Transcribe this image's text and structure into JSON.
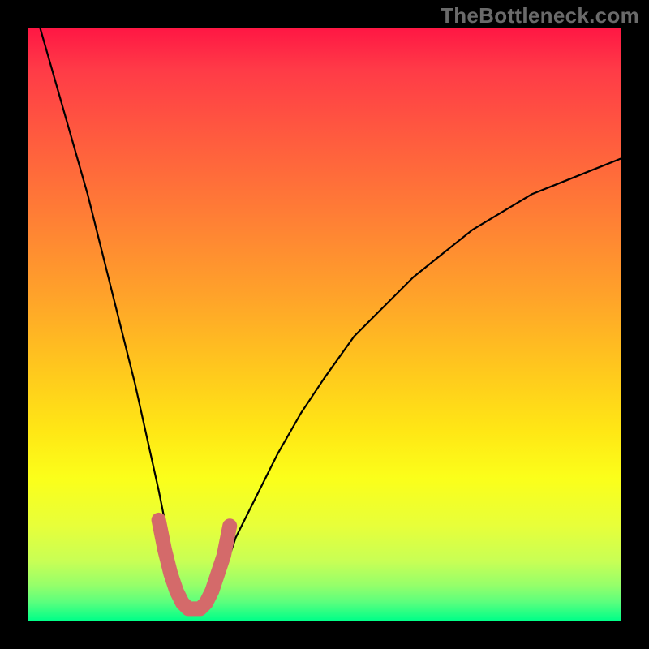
{
  "watermark": "TheBottleneck.com",
  "chart_data": {
    "type": "line",
    "title": "",
    "xlabel": "",
    "ylabel": "",
    "xlim": [
      0,
      100
    ],
    "ylim": [
      0,
      100
    ],
    "series": [
      {
        "name": "curve",
        "x": [
          2,
          4,
          6,
          8,
          10,
          12,
          14,
          16,
          18,
          20,
          22,
          23,
          24,
          25,
          26,
          27,
          28,
          29,
          30,
          31,
          32,
          33,
          35,
          38,
          42,
          46,
          50,
          55,
          60,
          65,
          70,
          75,
          80,
          85,
          90,
          95,
          100
        ],
        "values": [
          100,
          93,
          86,
          79,
          72,
          64,
          56,
          48,
          40,
          31,
          22,
          17,
          12,
          8,
          5,
          3,
          2,
          2,
          2,
          3,
          5,
          8,
          14,
          20,
          28,
          35,
          41,
          48,
          53,
          58,
          62,
          66,
          69,
          72,
          74,
          76,
          78
        ]
      },
      {
        "name": "highlight",
        "x": [
          22,
          23,
          24,
          25,
          26,
          27,
          28,
          29,
          30,
          31,
          32,
          33,
          34
        ],
        "values": [
          17,
          12,
          8,
          5,
          3,
          2,
          2,
          2,
          3,
          5,
          8,
          11,
          16
        ]
      }
    ],
    "colors": {
      "curve": "#000000",
      "highlight": "#d46a6a"
    }
  }
}
